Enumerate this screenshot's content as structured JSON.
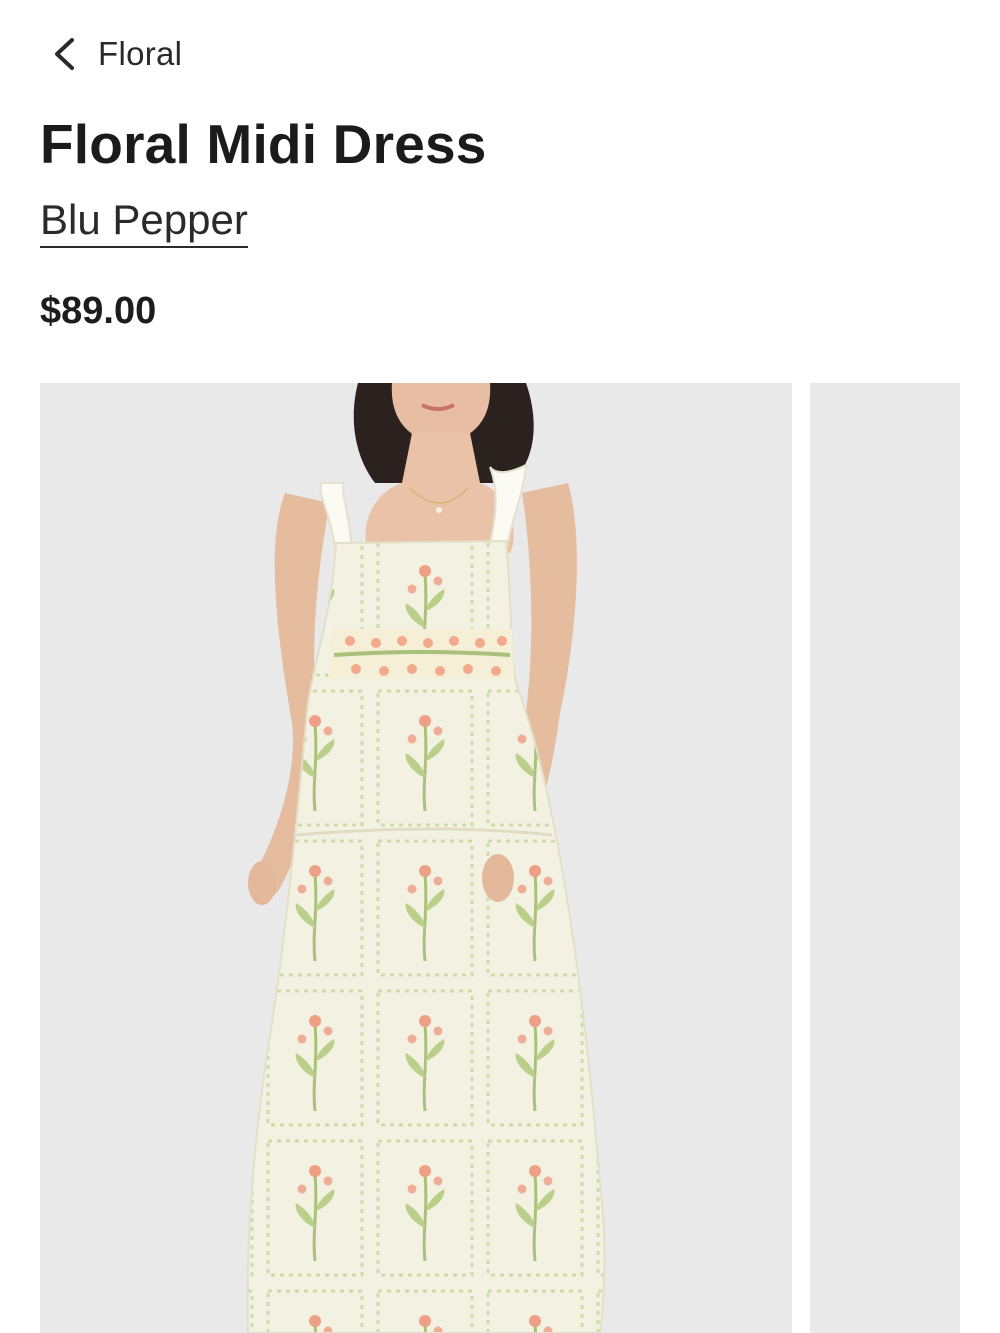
{
  "nav": {
    "back_label": "Floral",
    "back_icon": "chevron-left-icon"
  },
  "product": {
    "title": "Floral Midi Dress",
    "brand": "Blu Pepper",
    "price": "$89.00"
  },
  "gallery": {
    "images": [
      {
        "subject": "model wearing floral midi dress"
      },
      {
        "subject": "next product image (partially visible)"
      }
    ]
  },
  "colors": {
    "photo_background": "#e9e9ea",
    "dress_base": "#f3f1e2",
    "floral_green": "#a9c17a",
    "floral_peach": "#ee9f86"
  }
}
